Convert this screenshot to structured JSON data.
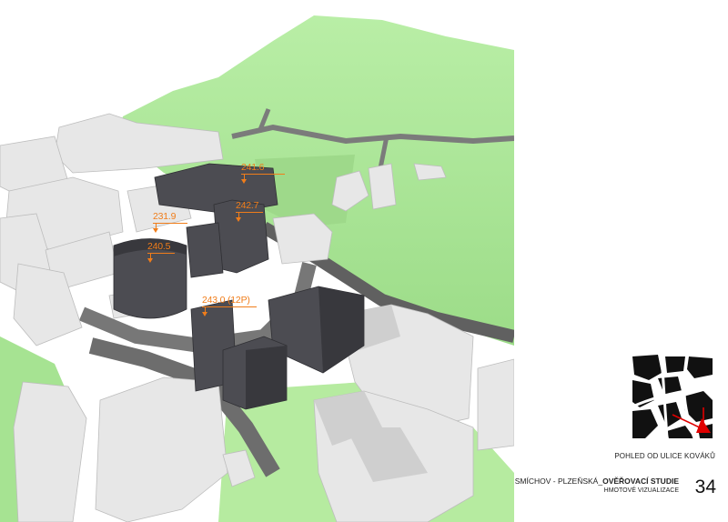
{
  "heights": [
    {
      "id": "h1",
      "text": "241.6"
    },
    {
      "id": "h2",
      "text": "242.7"
    },
    {
      "id": "h3",
      "text": "231.9"
    },
    {
      "id": "h4",
      "text": "240.5"
    },
    {
      "id": "h5",
      "text": "243.0 (12P)"
    }
  ],
  "caption": "POHLED OD ULICE KOVÁKŮ",
  "footer": {
    "title_prefix": "SMÍCHOV - PLZEŇSKÁ_",
    "title_bold": "OVĚŘOVACÍ STUDIE",
    "subtitle": "HMOTOVÉ VIZUALIZACE",
    "page_number": "34"
  },
  "colors": {
    "grass": "#a9e696",
    "building_white": "#e9e9e9",
    "building_dark": "#4d4d52",
    "road": "#6a6a6a",
    "label": "#f07d1a",
    "view_arrow": "#e00000"
  }
}
